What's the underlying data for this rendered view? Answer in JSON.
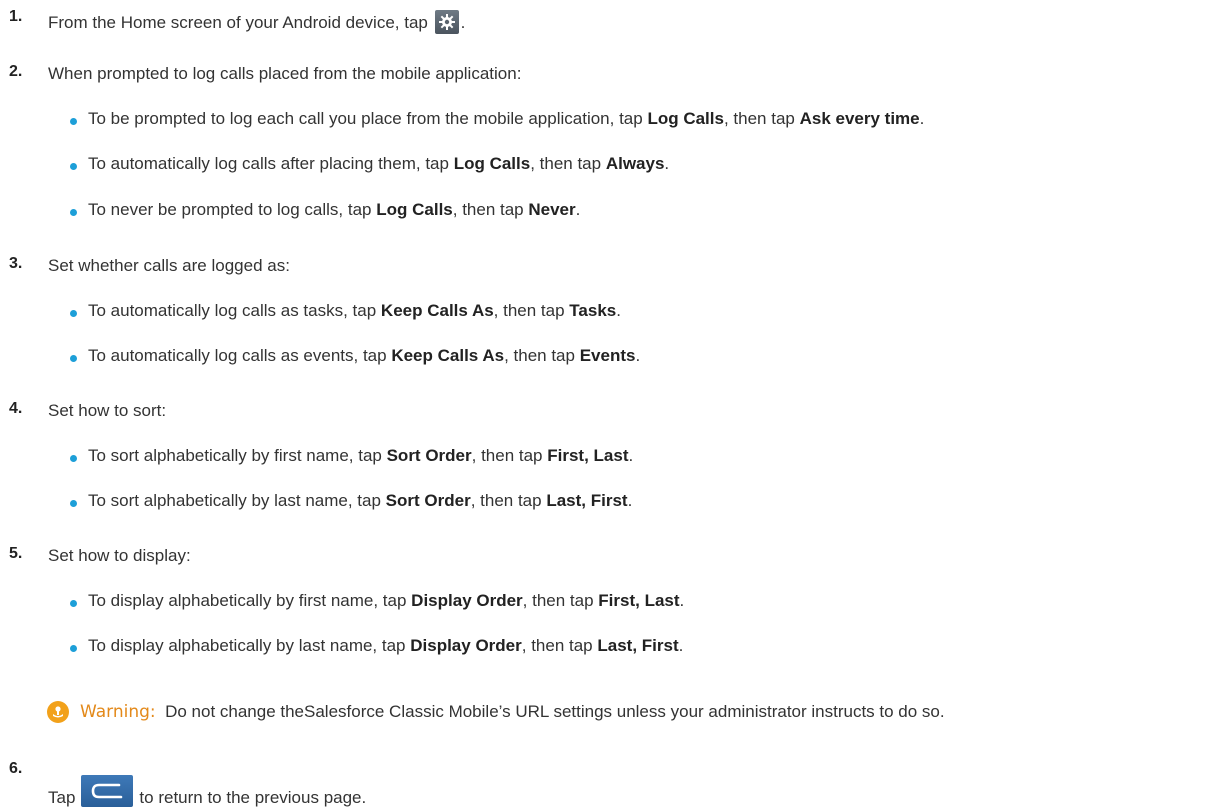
{
  "steps": [
    {
      "num": "1.",
      "text_before": "From the Home screen of your Android device, tap",
      "text_after": "."
    },
    {
      "num": "2.",
      "text": "When prompted to log calls placed from the mobile application:",
      "bullets": [
        {
          "pre": "To be prompted to log each call you place from the mobile application, tap ",
          "b1": "Log Calls",
          "mid": ", then tap ",
          "b2": "Ask every time",
          "post": "."
        },
        {
          "pre": "To automatically log calls after placing them, tap ",
          "b1": "Log Calls",
          "mid": ", then tap ",
          "b2": "Always",
          "post": "."
        },
        {
          "pre": "To never be prompted to log calls, tap ",
          "b1": "Log Calls",
          "mid": ", then tap ",
          "b2": "Never",
          "post": "."
        }
      ]
    },
    {
      "num": "3.",
      "text": "Set whether calls are logged as:",
      "bullets": [
        {
          "pre": "To automatically log calls as tasks, tap ",
          "b1": "Keep Calls As",
          "mid": ", then tap ",
          "b2": "Tasks",
          "post": "."
        },
        {
          "pre": "To automatically log calls as events, tap ",
          "b1": "Keep Calls As",
          "mid": ", then tap ",
          "b2": "Events",
          "post": "."
        }
      ]
    },
    {
      "num": "4.",
      "text": "Set how to sort:",
      "bullets": [
        {
          "pre": "To sort alphabetically by first name, tap ",
          "b1": "Sort Order",
          "mid": ", then tap ",
          "b2": "First, Last",
          "post": "."
        },
        {
          "pre": "To sort alphabetically by last name, tap ",
          "b1": "Sort Order",
          "mid": ", then tap ",
          "b2": "Last, First",
          "post": "."
        }
      ]
    },
    {
      "num": "5.",
      "text": "Set how to display:",
      "bullets": [
        {
          "pre": "To display alphabetically by first name, tap ",
          "b1": "Display Order",
          "mid": ", then tap ",
          "b2": "First, Last",
          "post": "."
        },
        {
          "pre": "To display alphabetically by last name, tap ",
          "b1": "Display Order",
          "mid": ", then tap ",
          "b2": "Last, First",
          "post": "."
        }
      ]
    },
    {
      "num": "6.",
      "text_before": "Tap",
      "text_after": "to return to the previous page."
    }
  ],
  "warning": {
    "label": "Warning:",
    "text": "Do not change theSalesforce Classic Mobile’s URL settings unless your administrator instructs to do so."
  },
  "icons": {
    "settings": "gear-icon",
    "back": "back-arrow-icon",
    "warning": "warning-icon"
  },
  "colors": {
    "bullet": "#1d9fd8",
    "warning_label": "#e3891a",
    "warning_icon": "#f2a11a",
    "back_button": "#2f6aa8"
  }
}
